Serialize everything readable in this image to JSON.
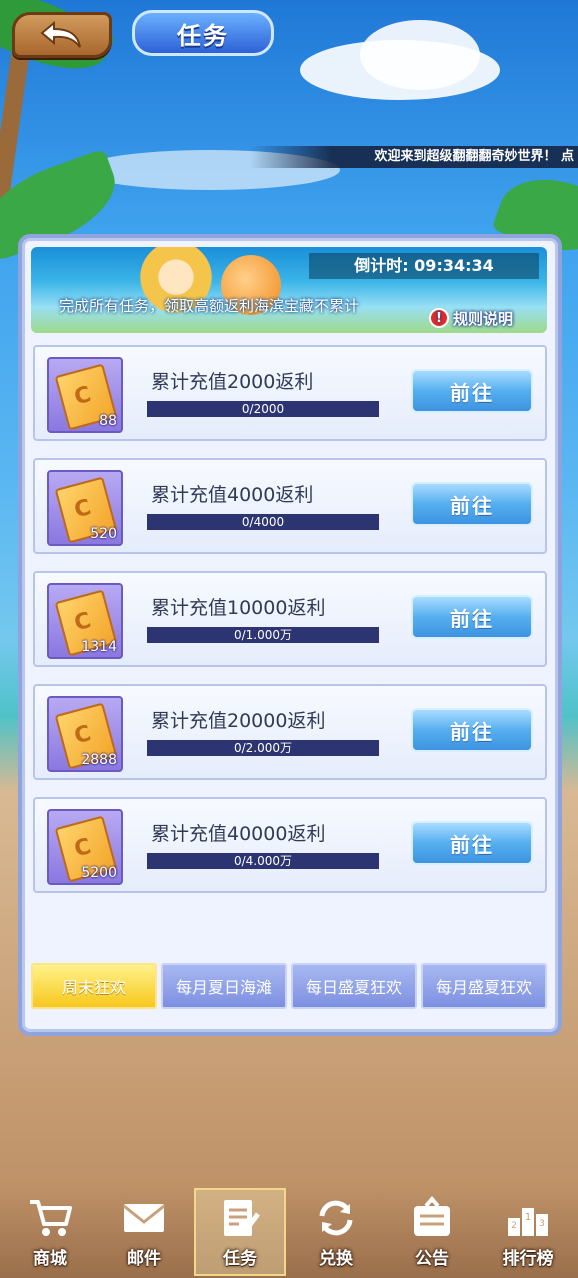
{
  "header": {
    "title": "任务",
    "marquee": "欢迎来到超级翻翻翻奇妙世界！ 点"
  },
  "banner": {
    "countdown": "倒计时: 09:34:34",
    "description": "完成所有任务，领取高额返利海滨宝藏不累计",
    "rules_label": "规则说明"
  },
  "tasks": [
    {
      "title": "累计充值2000返利",
      "count": "88",
      "progress_text": "0/2000",
      "progress": 0,
      "button": "前往"
    },
    {
      "title": "累计充值4000返利",
      "count": "520",
      "progress_text": "0/4000",
      "progress": 0,
      "button": "前往"
    },
    {
      "title": "累计充值10000返利",
      "count": "1314",
      "progress_text": "0/1.000万",
      "progress": 0,
      "button": "前往"
    },
    {
      "title": "累计充值20000返利",
      "count": "2888",
      "progress_text": "0/2.000万",
      "progress": 0,
      "button": "前往"
    },
    {
      "title": "累计充值40000返利",
      "count": "5200",
      "progress_text": "0/4.000万",
      "progress": 0,
      "button": "前往"
    }
  ],
  "tabs": [
    {
      "label": "周末狂欢",
      "active": true
    },
    {
      "label": "每月夏日海滩",
      "active": false
    },
    {
      "label": "每日盛夏狂欢",
      "active": false
    },
    {
      "label": "每月盛夏狂欢",
      "active": false
    }
  ],
  "nav": [
    {
      "label": "商城",
      "icon": "cart-icon"
    },
    {
      "label": "邮件",
      "icon": "mail-icon"
    },
    {
      "label": "任务",
      "icon": "task-icon",
      "active": true
    },
    {
      "label": "兑换",
      "icon": "exchange-icon"
    },
    {
      "label": "公告",
      "icon": "announcement-icon"
    },
    {
      "label": "排行榜",
      "icon": "ranking-icon"
    }
  ],
  "colors": {
    "accent": "#3d93e0",
    "active_tab": "#f7c81e",
    "progress_track": "#2c3472"
  }
}
